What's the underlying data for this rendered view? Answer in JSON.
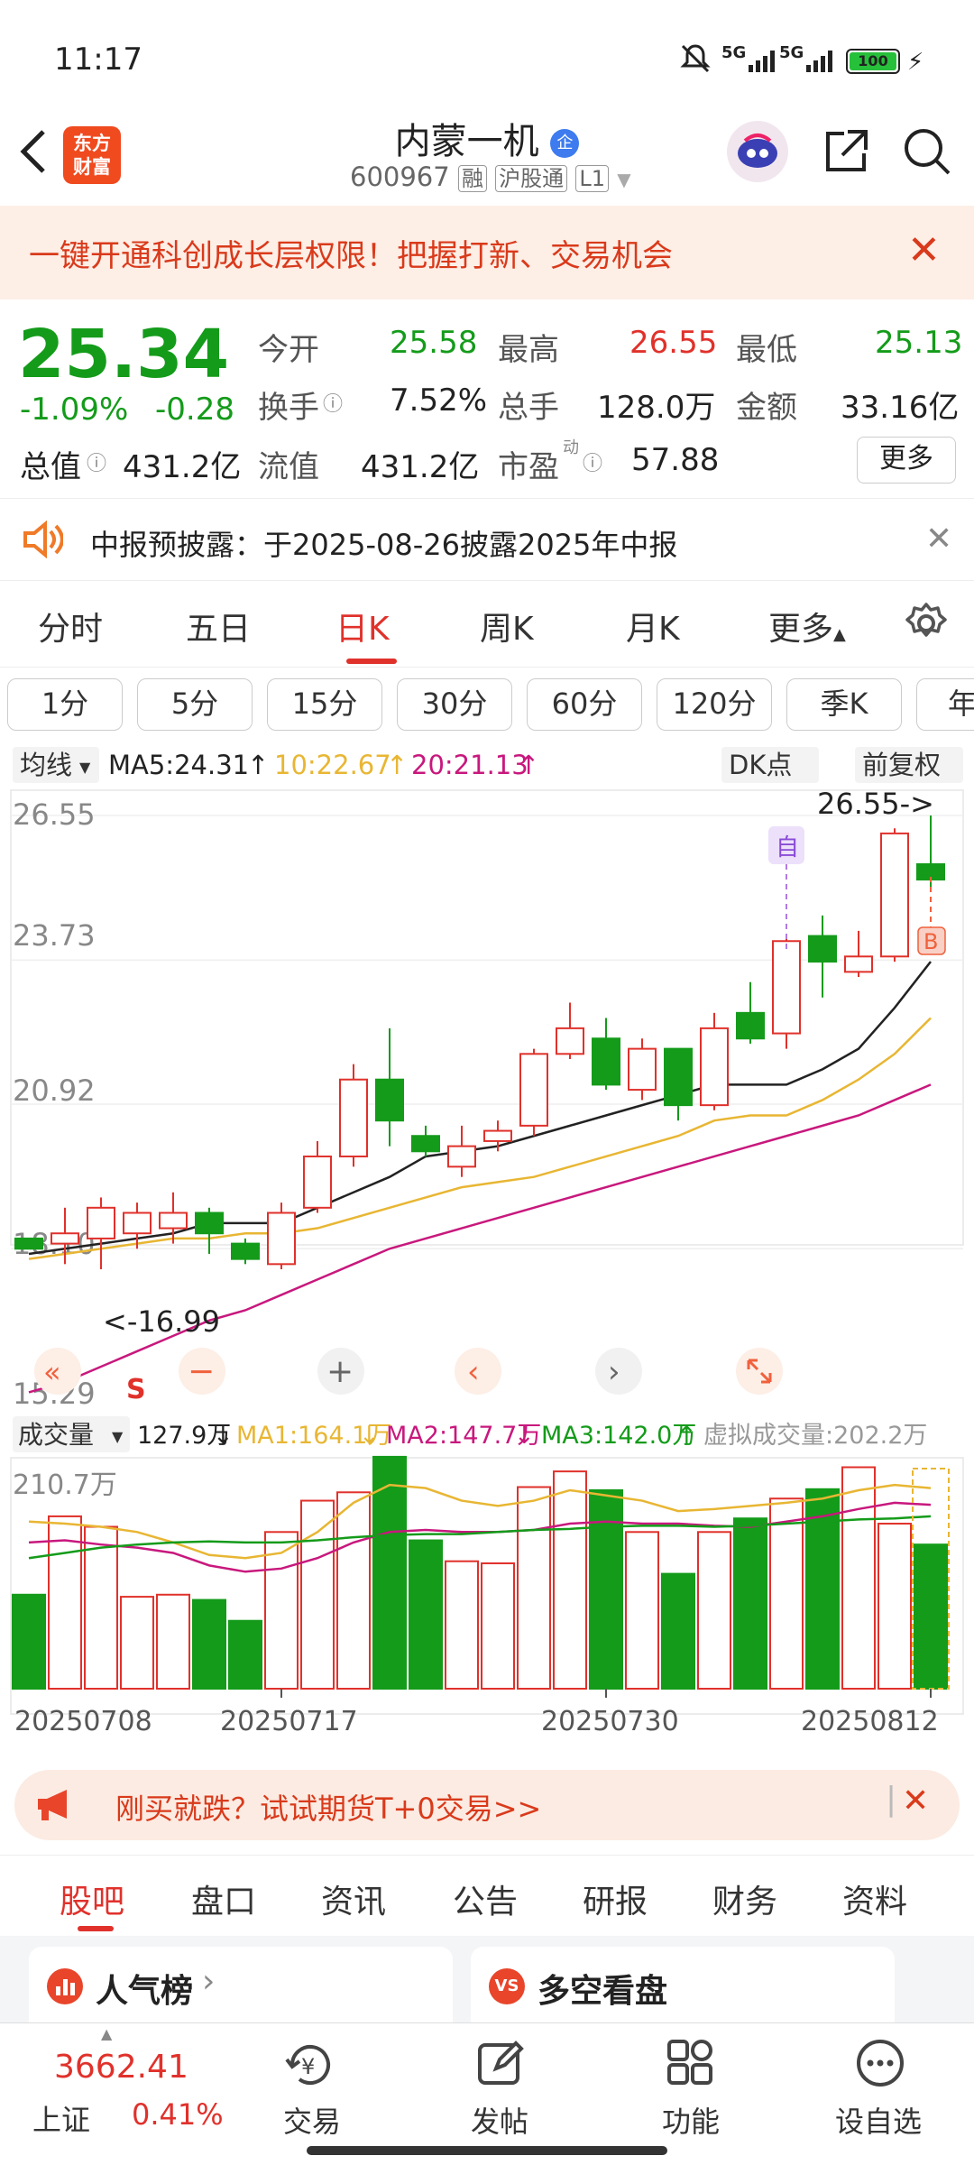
{
  "status": {
    "time": "11:17",
    "signal1": "5G",
    "signal2": "5G",
    "battery": "100"
  },
  "header": {
    "logo_line1": "东方",
    "logo_line2": "财富",
    "stock_name": "内蒙一机",
    "stock_code": "600967",
    "tag1": "融",
    "tag2": "沪股通",
    "tag3": "L1",
    "badge": "企"
  },
  "promo": {
    "text": "一键开通科创成长层权限！把握打新、交易机会"
  },
  "quote": {
    "price": "25.34",
    "pct": "-1.09%",
    "chg": "-0.28",
    "open_label": "今开",
    "open": "25.58",
    "high_label": "最高",
    "high": "26.55",
    "low_label": "最低",
    "low": "25.13",
    "turnover_label": "换手",
    "turnover": "7.52%",
    "volume_label": "总手",
    "volume": "128.0万",
    "amount_label": "金额",
    "amount": "33.16亿",
    "mktcap_label": "总值",
    "mktcap": "431.2亿",
    "float_label": "流值",
    "float": "431.2亿",
    "pe_label": "市盈",
    "pe_sup": "动",
    "pe": "57.88",
    "more": "更多"
  },
  "notice": {
    "text": "中报预披露：于2025-08-26披露2025年中报"
  },
  "tabs": [
    "分时",
    "五日",
    "日K",
    "周K",
    "月K",
    "更多"
  ],
  "active_tab": "日K",
  "periods": [
    "1分",
    "5分",
    "15分",
    "30分",
    "60分",
    "120分",
    "季K",
    "年"
  ],
  "ma_legend": {
    "type": "均线",
    "ma5": "MA5:24.31",
    "ma10": "10:22.67",
    "ma20": "20:21.13",
    "dk": "DK点",
    "fq": "前复权"
  },
  "price_axis": [
    "26.55",
    "23.73",
    "20.92",
    "18.10",
    "15.29"
  ],
  "annotations": {
    "high": "26.55->",
    "low": "<-16.99",
    "self": "自",
    "buy": "B",
    "sell": "S"
  },
  "vol_legend": {
    "label": "成交量",
    "vol": "127.9万",
    "ma1": "MA1:164.1万",
    "ma2": "MA2:147.7万",
    "ma3": "MA3:142.0万",
    "virtual": "虚拟成交量:202.2万",
    "axis_max": "210.7万"
  },
  "date_axis": [
    "20250708",
    "20250717",
    "20250730",
    "20250812"
  ],
  "ad": {
    "text": "刚买就跌？试试期货T+0交易>>"
  },
  "bottom_tabs": [
    "股吧",
    "盘口",
    "资讯",
    "公告",
    "研报",
    "财务",
    "资料"
  ],
  "cards": {
    "left": "人气榜",
    "right": "多空看盘"
  },
  "footer": {
    "index_value": "3662.41",
    "index_name": "上证",
    "index_pct": "0.41%",
    "trade": "交易",
    "post": "发帖",
    "func": "功能",
    "watch": "设自选"
  },
  "colors": {
    "up": "#e0312b",
    "down": "#149b1a",
    "accent": "#e0312b",
    "ma5": "#222222",
    "ma10": "#e8b633",
    "ma20": "#c8187d"
  },
  "chart_data": {
    "type": "candlestick",
    "ylim": [
      15.29,
      26.55
    ],
    "candles": [
      {
        "o": 18.3,
        "c": 18.1,
        "h": 18.3,
        "l": 18.1
      },
      {
        "o": 18.2,
        "c": 18.4,
        "h": 18.9,
        "l": 17.8
      },
      {
        "o": 18.3,
        "c": 18.9,
        "h": 19.1,
        "l": 17.7
      },
      {
        "o": 18.4,
        "c": 18.8,
        "h": 19.0,
        "l": 18.1
      },
      {
        "o": 18.5,
        "c": 18.8,
        "h": 19.2,
        "l": 18.2
      },
      {
        "o": 18.8,
        "c": 18.4,
        "h": 18.9,
        "l": 18.0
      },
      {
        "o": 18.2,
        "c": 17.9,
        "h": 18.3,
        "l": 17.8
      },
      {
        "o": 17.8,
        "c": 18.8,
        "h": 19.0,
        "l": 17.7
      },
      {
        "o": 18.9,
        "c": 19.9,
        "h": 20.2,
        "l": 18.8
      },
      {
        "o": 19.9,
        "c": 21.4,
        "h": 21.7,
        "l": 19.7
      },
      {
        "o": 21.4,
        "c": 20.6,
        "h": 22.4,
        "l": 20.1
      },
      {
        "o": 20.3,
        "c": 20.0,
        "h": 20.5,
        "l": 19.9
      },
      {
        "o": 19.7,
        "c": 20.1,
        "h": 20.5,
        "l": 19.5
      },
      {
        "o": 20.2,
        "c": 20.4,
        "h": 20.6,
        "l": 20.0
      },
      {
        "o": 20.5,
        "c": 21.9,
        "h": 22.0,
        "l": 20.3
      },
      {
        "o": 21.9,
        "c": 22.4,
        "h": 22.9,
        "l": 21.8
      },
      {
        "o": 22.2,
        "c": 21.3,
        "h": 22.6,
        "l": 21.2
      },
      {
        "o": 21.2,
        "c": 22.0,
        "h": 22.2,
        "l": 21.0
      },
      {
        "o": 22.0,
        "c": 20.9,
        "h": 22.0,
        "l": 20.6
      },
      {
        "o": 20.9,
        "c": 22.4,
        "h": 22.7,
        "l": 20.8
      },
      {
        "o": 22.7,
        "c": 22.2,
        "h": 23.3,
        "l": 22.1
      },
      {
        "o": 22.3,
        "c": 24.1,
        "h": 24.2,
        "l": 22.0
      },
      {
        "o": 24.2,
        "c": 23.7,
        "h": 24.6,
        "l": 23.0
      },
      {
        "o": 23.5,
        "c": 23.8,
        "h": 24.3,
        "l": 23.4
      },
      {
        "o": 23.8,
        "c": 26.2,
        "h": 26.3,
        "l": 23.7
      },
      {
        "o": 25.6,
        "c": 25.3,
        "h": 26.55,
        "l": 25.1
      }
    ],
    "ma5": [
      18.0,
      18.1,
      18.2,
      18.3,
      18.4,
      18.6,
      18.6,
      18.6,
      18.9,
      19.2,
      19.5,
      19.9,
      20.0,
      20.1,
      20.3,
      20.5,
      20.7,
      20.9,
      21.1,
      21.3,
      21.3,
      21.3,
      21.6,
      22.0,
      22.8,
      23.7
    ],
    "ma10": [
      17.9,
      18.0,
      18.1,
      18.2,
      18.3,
      18.3,
      18.4,
      18.4,
      18.5,
      18.7,
      18.9,
      19.1,
      19.3,
      19.4,
      19.5,
      19.7,
      19.9,
      20.1,
      20.3,
      20.6,
      20.7,
      20.7,
      21.0,
      21.4,
      21.9,
      22.6
    ],
    "ma20": [
      15.3,
      15.5,
      15.8,
      16.1,
      16.4,
      16.7,
      16.9,
      17.2,
      17.5,
      17.8,
      18.1,
      18.3,
      18.5,
      18.7,
      18.9,
      19.1,
      19.3,
      19.5,
      19.7,
      19.9,
      20.1,
      20.3,
      20.5,
      20.7,
      21.0,
      21.3
    ],
    "volumes": [
      90,
      165,
      155,
      88,
      90,
      85,
      65,
      150,
      180,
      188,
      222,
      142,
      122,
      120,
      193,
      208,
      190,
      150,
      110,
      150,
      163,
      182,
      191,
      212,
      158,
      138
    ],
    "vol_ma1": [
      160,
      158,
      155,
      150,
      140,
      128,
      125,
      130,
      150,
      178,
      195,
      192,
      180,
      175,
      180,
      190,
      185,
      180,
      170,
      172,
      175,
      178,
      182,
      190,
      195,
      192
    ],
    "vol_ma2": [
      140,
      142,
      138,
      135,
      130,
      118,
      112,
      115,
      125,
      140,
      150,
      152,
      150,
      150,
      152,
      158,
      160,
      158,
      158,
      156,
      155,
      160,
      165,
      172,
      178,
      176
    ],
    "vol_ma3": [
      125,
      130,
      135,
      138,
      140,
      141,
      140,
      140,
      142,
      145,
      147,
      148,
      148,
      150,
      152,
      153,
      155,
      156,
      156,
      155,
      156,
      158,
      160,
      162,
      163,
      165
    ],
    "vol_max": 210.7
  }
}
